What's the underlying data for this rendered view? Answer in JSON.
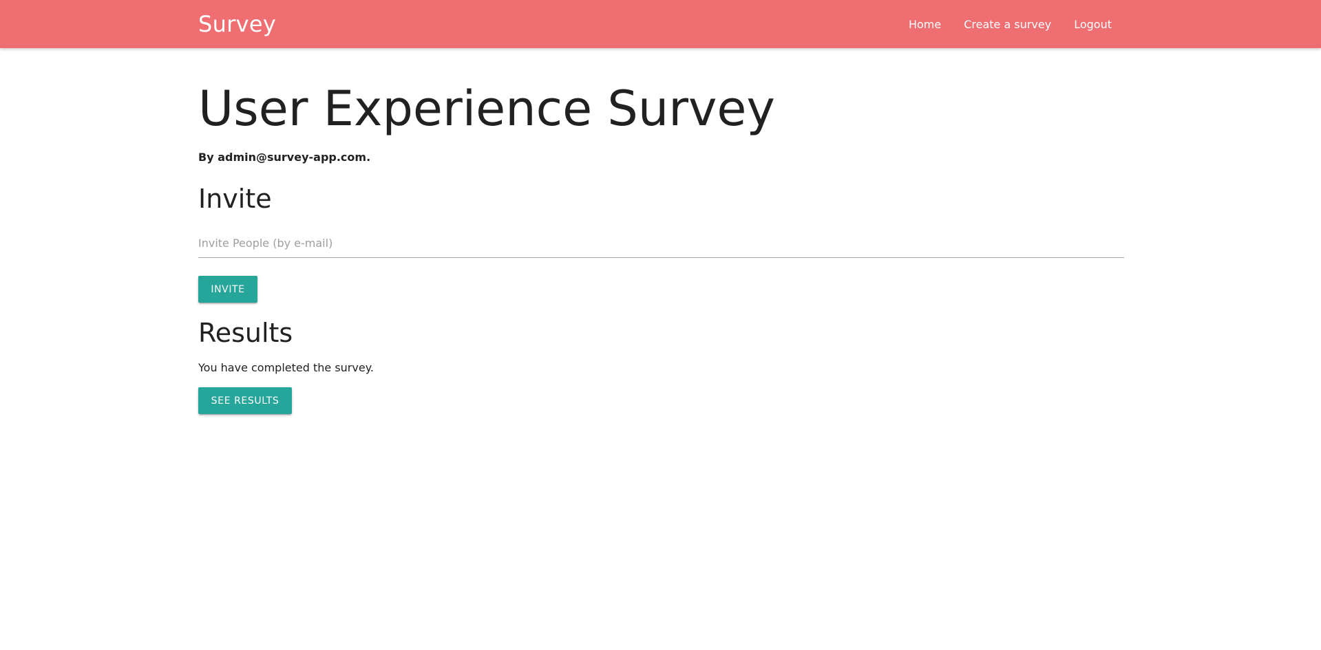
{
  "navbar": {
    "brand": "Survey",
    "links": [
      {
        "label": "Home"
      },
      {
        "label": "Create a survey"
      },
      {
        "label": "Logout"
      }
    ]
  },
  "survey": {
    "title": "User Experience Survey",
    "author_line": "By admin@survey-app.com."
  },
  "invite": {
    "heading": "Invite",
    "placeholder": "Invite People (by e-mail)",
    "value": "",
    "button_label": "Invite"
  },
  "results": {
    "heading": "Results",
    "status_text": "You have completed the survey.",
    "button_label": "See results"
  },
  "colors": {
    "navbar_bg": "#ef6e72",
    "button_bg": "#26a69a"
  }
}
